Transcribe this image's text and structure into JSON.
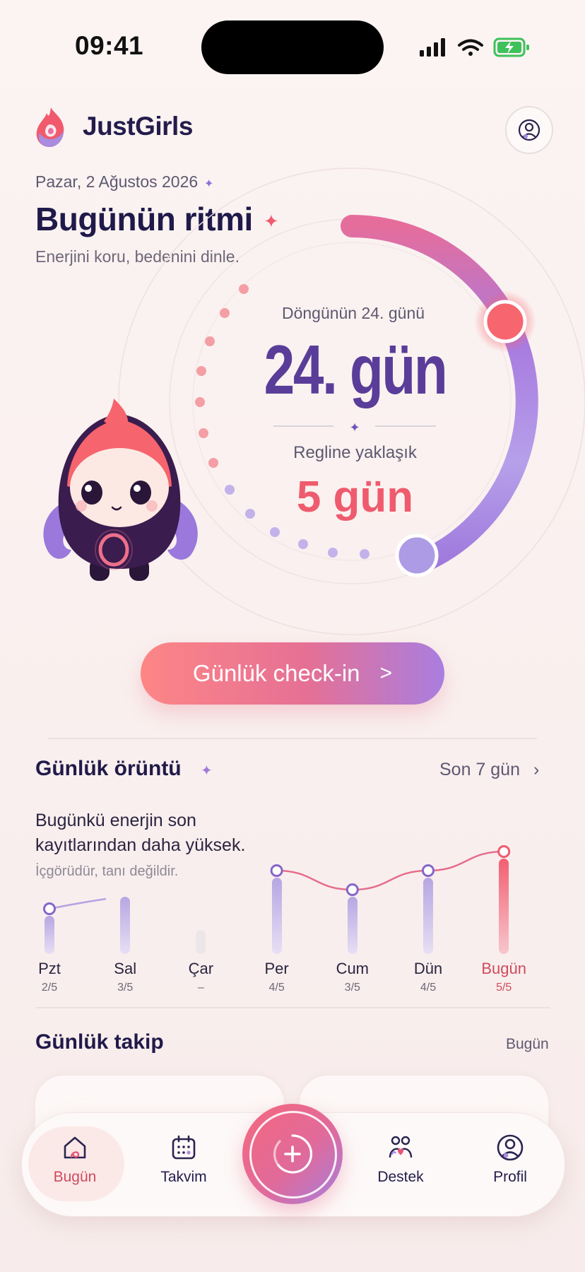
{
  "status_bar": {
    "time": "09:41"
  },
  "app": {
    "name": "JustGirls"
  },
  "header": {
    "date": "Pazar, 2 Ağustos 2026",
    "title": "Bugünün ritmi",
    "subtitle": "Enerjini koru, bedenini dinle."
  },
  "cycle": {
    "day_label": "Döngünün 24. günü",
    "day_value": "24. gün",
    "period_label": "Regline yaklaşık",
    "period_value": "5 gün",
    "progress_fraction": 0.86
  },
  "checkin": {
    "label": "Günlük check-in",
    "chevron": ">"
  },
  "pattern": {
    "title": "Günlük örüntü",
    "range_link": "Son 7 gün",
    "insight": "Bugünkü enerjin son kayıtlarından daha yüksek.",
    "disclaimer": "İçgörüdür, tanı değildir.",
    "days": [
      {
        "label": "Pzt",
        "value": "2/5",
        "score": 2
      },
      {
        "label": "Sal",
        "value": "3/5",
        "score": 3
      },
      {
        "label": "Çar",
        "value": "–",
        "score": null
      },
      {
        "label": "Per",
        "value": "4/5",
        "score": 4
      },
      {
        "label": "Cum",
        "value": "3/5",
        "score": 3
      },
      {
        "label": "Dün",
        "value": "4/5",
        "score": 4
      },
      {
        "label": "Bugün",
        "value": "5/5",
        "score": 5
      }
    ]
  },
  "tracking": {
    "title": "Günlük takip",
    "link": "Bugün"
  },
  "nav": {
    "items": [
      {
        "label": "Bugün",
        "icon": "home-icon",
        "active": true
      },
      {
        "label": "Takvim",
        "icon": "calendar-icon"
      },
      {
        "label": "Destek",
        "icon": "support-icon"
      },
      {
        "label": "Profil",
        "icon": "profile-icon"
      }
    ],
    "fab_icon": "add-icon"
  },
  "colors": {
    "primary_purple": "#5a3d99",
    "coral": "#ef5b6e",
    "lavender": "#a98be0",
    "background": "#fbf4f2"
  }
}
